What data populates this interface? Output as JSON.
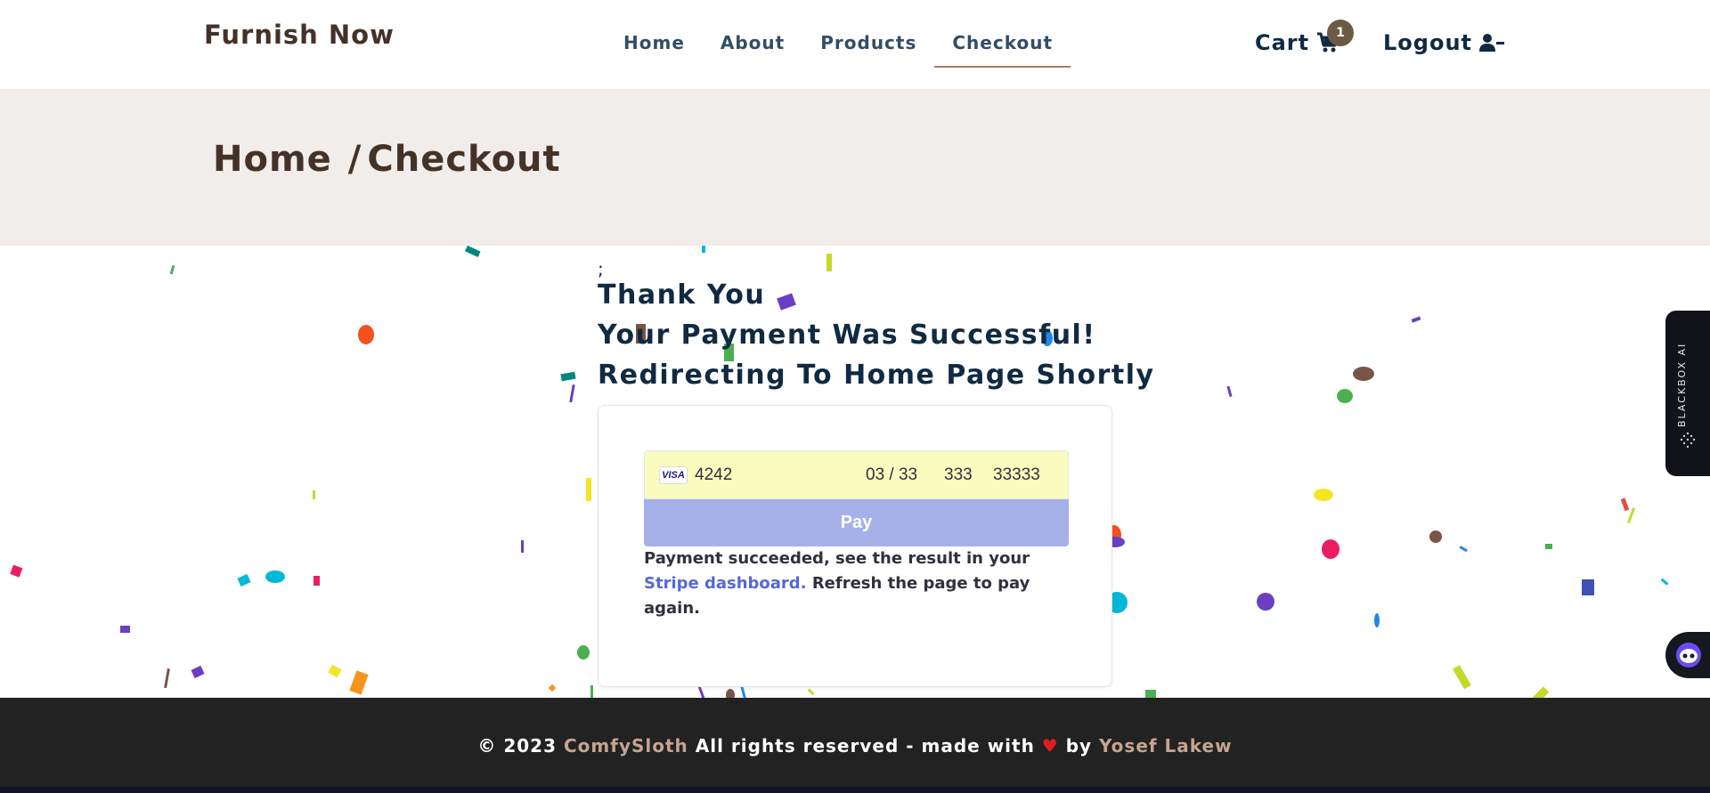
{
  "navbar": {
    "brand": "Furnish Now",
    "links": [
      "Home",
      "About",
      "Products",
      "Checkout"
    ],
    "active_link": "Checkout",
    "cart_label": "Cart",
    "cart_count": "1",
    "logout_label": "Logout"
  },
  "hero": {
    "crumb_home": "Home",
    "crumb_sep": "/",
    "crumb_current": "Checkout"
  },
  "main": {
    "stray_char": ";",
    "line1": "Thank You",
    "line2": "Your Payment Was Successful!",
    "line3": "Redirecting To Home Page Shortly"
  },
  "payment": {
    "card_brand": "VISA",
    "card_number": "4242",
    "expiry": "03 / 33",
    "cvc": "333",
    "zip": "33333",
    "pay_label": "Pay",
    "result_before": "Payment succeeded, see the result in your",
    "result_link": "Stripe dashboard.",
    "result_after": "Refresh the page to pay again."
  },
  "footer": {
    "copyright": "© 2023",
    "brand": "ComfySloth",
    "text_mid": "All rights reserved - made with",
    "heart": "♥",
    "by": "by",
    "author": "Yosef Lakew"
  },
  "widgets": {
    "blackbox_label": "BLACKBOX AI"
  },
  "colors": {
    "brand": "#453227",
    "accent": "#ab7a5f",
    "hero_bg": "#f1edea",
    "pay_button": "#a6b1e9",
    "card_input": "#fafcbf",
    "footer_bg": "#222222"
  }
}
